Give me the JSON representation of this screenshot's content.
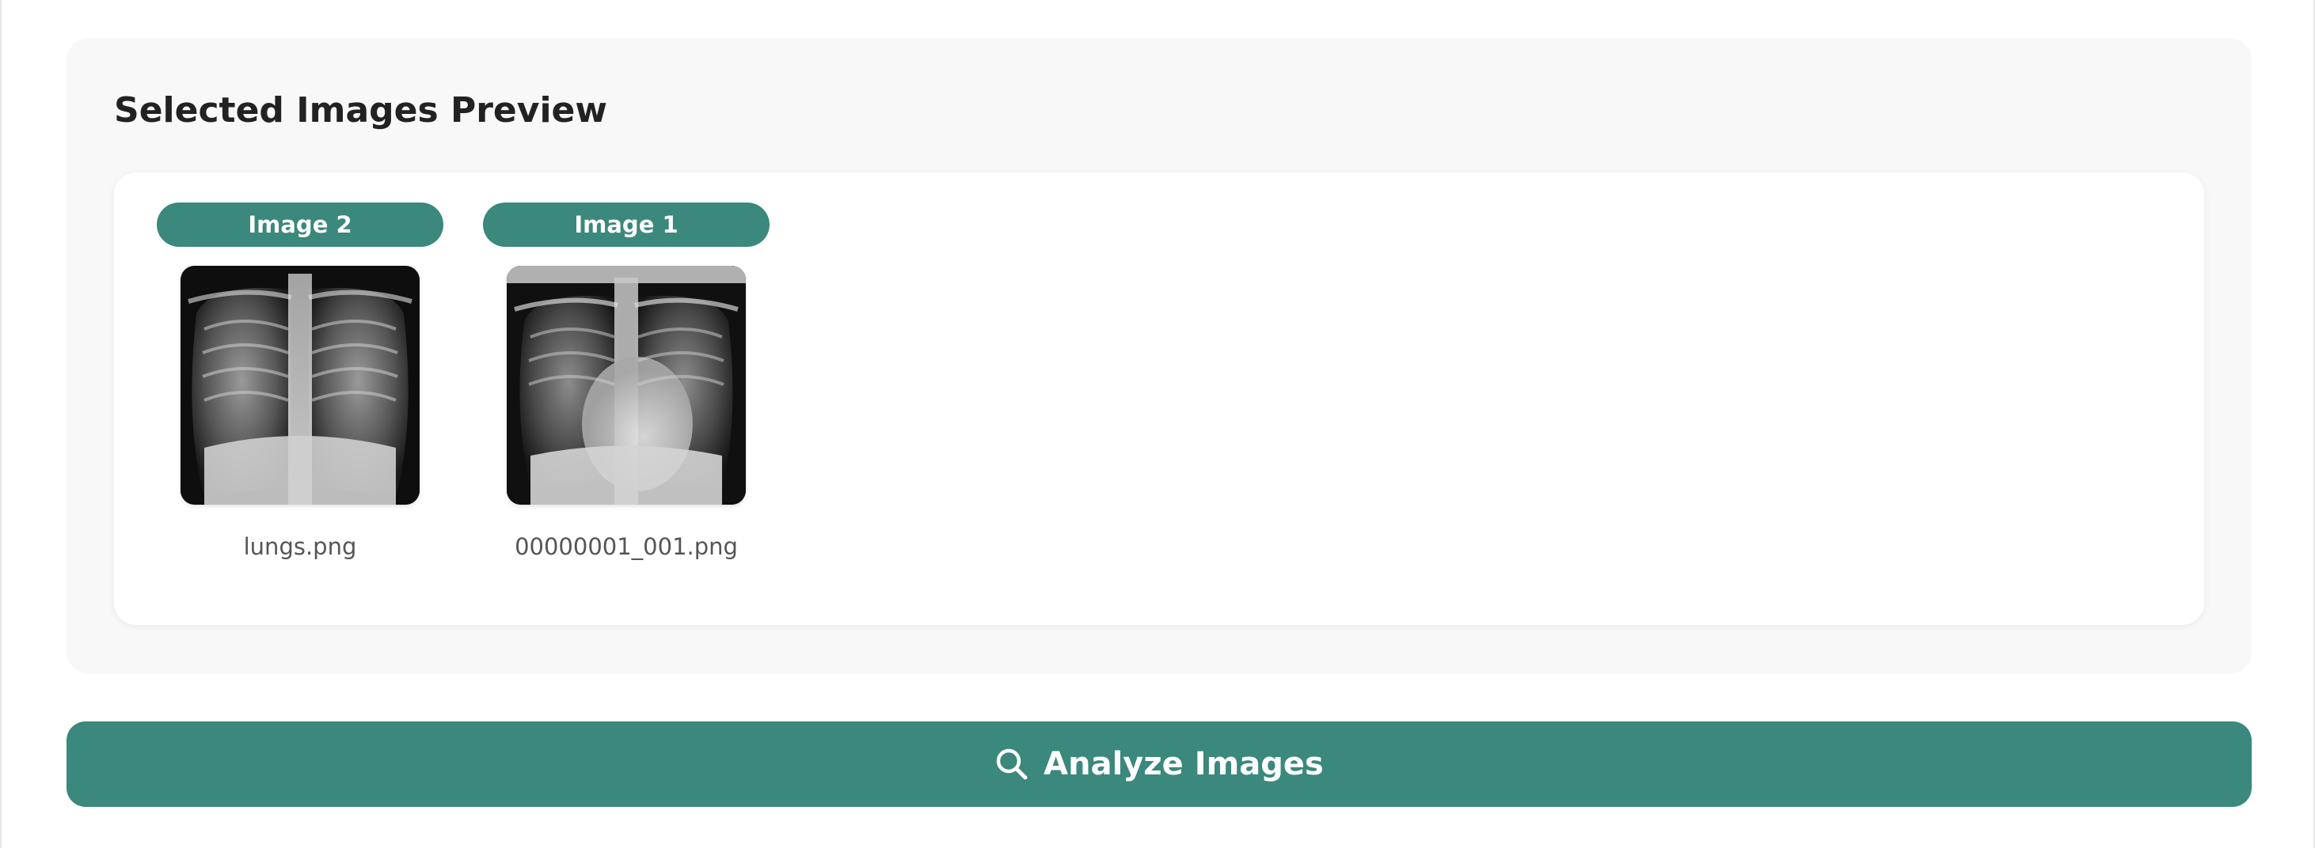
{
  "preview": {
    "title": "Selected Images Preview",
    "images": [
      {
        "badge": "Image 2",
        "filename": "lungs.png"
      },
      {
        "badge": "Image 1",
        "filename": "00000001_001.png"
      }
    ]
  },
  "actions": {
    "analyze_label": "Analyze Images",
    "analyze_icon": "search-icon"
  },
  "colors": {
    "accent": "#3b887c",
    "section_bg": "#f8f8f8",
    "card_bg": "#ffffff"
  }
}
